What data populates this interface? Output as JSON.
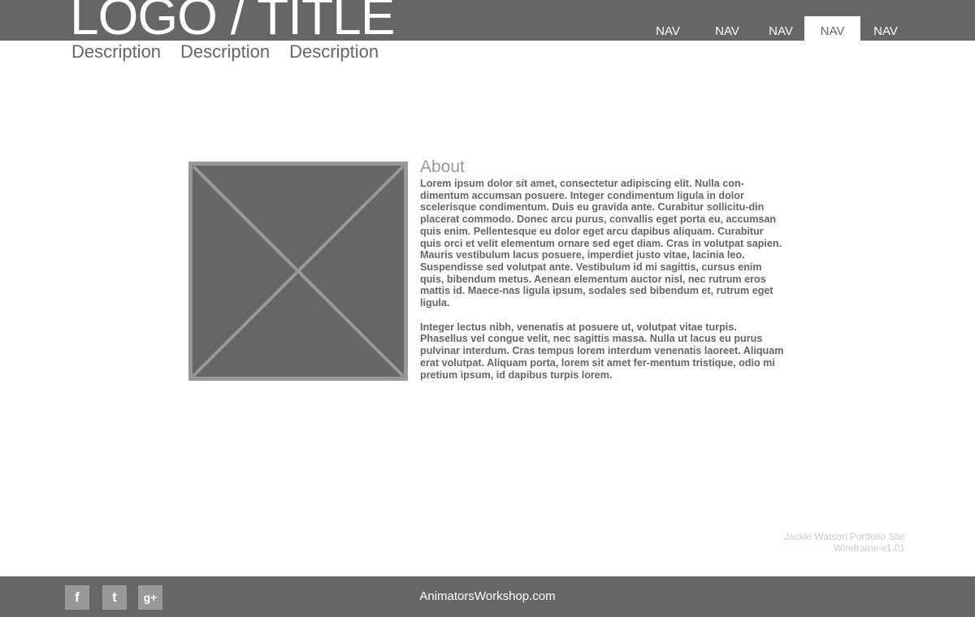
{
  "header": {
    "logo_title": "LOGO / TITLE",
    "descriptions": [
      "Description",
      "Description",
      "Description"
    ],
    "nav": [
      "NAV",
      "NAV",
      "NAV",
      "NAV",
      "NAV"
    ],
    "active_nav_index": 3
  },
  "main": {
    "image_placeholder_icon": "image-placeholder-icon",
    "about": {
      "heading": "About",
      "paragraphs": [
        "Lorem ipsum dolor sit amet, consectetur adipiscing elit. Nulla con-dimentum accumsan posuere. Integer condimentum ligula in dolor scelerisque condimentum. Duis eu gravida ante. Curabitur sollicitu-din placerat commodo. Donec arcu purus, convallis eget porta eu, accumsan quis enim. Pellentesque eu dolor eget arcu dapibus aliquam. Curabitur quis orci et velit elementum ornare sed eget diam. Cras in volutpat sapien. Mauris vestibulum lacus posuere, imperdiet justo vitae, lacinia leo. Suspendisse sed volutpat ante. Vestibulum id mi sagittis, cursus enim quis, bibendum metus. Aenean elementum auctor nisl, nec rutrum eros mattis id. Maece-nas ligula ipsum, sodales sed bibendum et, rutrum eget ligula.",
        "Integer lectus nibh, venenatis at posuere ut, volutpat vitae turpis. Phasellus vel congue velit, nec sagittis massa. Nulla ut lacus eu purus pulvinar interdum. Cras tempus lorem interdum venenatis laoreet. Aliquam erat volutpat. Aliquam porta, lorem sit amet fer-mentum tristique, odio mi pretium ipsum, id dapibus turpis lorem."
      ]
    }
  },
  "credit": {
    "line1": "Jackie Watson Portfolio Site",
    "line2": "Wireframe v1.01"
  },
  "footer": {
    "social": [
      {
        "label": "f",
        "icon": "facebook-icon"
      },
      {
        "label": "t",
        "icon": "twitter-icon"
      },
      {
        "label": "g+",
        "icon": "google-plus-icon"
      }
    ],
    "site": "AnimatorsWorkshop.com"
  },
  "colors": {
    "bar": "#666666",
    "placeholder_fill": "#666666",
    "placeholder_border": "#989898",
    "social_bg": "#999999",
    "credit_text": "#cccccc"
  }
}
